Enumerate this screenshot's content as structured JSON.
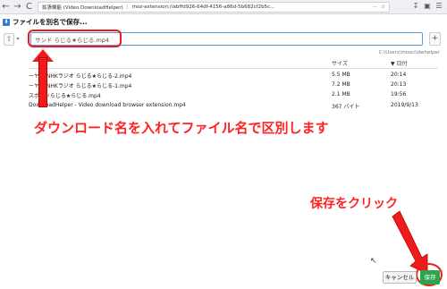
{
  "browser": {
    "ext_title": "拡張機能 (Video DownloadHelper)",
    "url": "moz-extension://abffd926-64df-4156-a86d-5b682cf2b5c...",
    "nav_back": "←",
    "nav_forward": "→",
    "nav_reload": "C",
    "nav_home": "⌂",
    "more": "···",
    "star": "☆",
    "right_icons": [
      "↧",
      "▣",
      "☰"
    ]
  },
  "dialog": {
    "title": "ファイルを別名で保存...",
    "up_label": "⇧",
    "dropdown_label": "▾",
    "filename_value": "サンド らじる★らじる.mp4",
    "add_label": "+",
    "directory": "C:\\Users\\mosci\\dwhelper"
  },
  "table": {
    "headers": {
      "name": "",
      "size": "サイズ",
      "date": "▼ 日付"
    },
    "rows": [
      {
        "name": "ーヤー NHKラジオ らじる★らじる-2.mp4",
        "size": "5.5 MB",
        "date": "20:14"
      },
      {
        "name": "ーヤー NHKラジオ らじる★らじる-1.mp4",
        "size": "7.2 MB",
        "date": "20:13"
      },
      {
        "name": "スポーツらじる★らじる.mp4",
        "size": "2.1 MB",
        "date": "19:56"
      },
      {
        "name": "DownloadHelper - Video download browser extension.mp4",
        "size": "367 バイト",
        "date": "2019/9/13"
      }
    ]
  },
  "annotations": {
    "main_note": "ダウンロード名を入れてファイル名で区別します",
    "save_note": "保存をクリック"
  },
  "buttons": {
    "cancel": "キャンセル",
    "save": "保存"
  },
  "colors": {
    "annotation_red": "#ee1c1c",
    "save_green": "#2da44e",
    "focus_blue": "#5a9be6"
  }
}
